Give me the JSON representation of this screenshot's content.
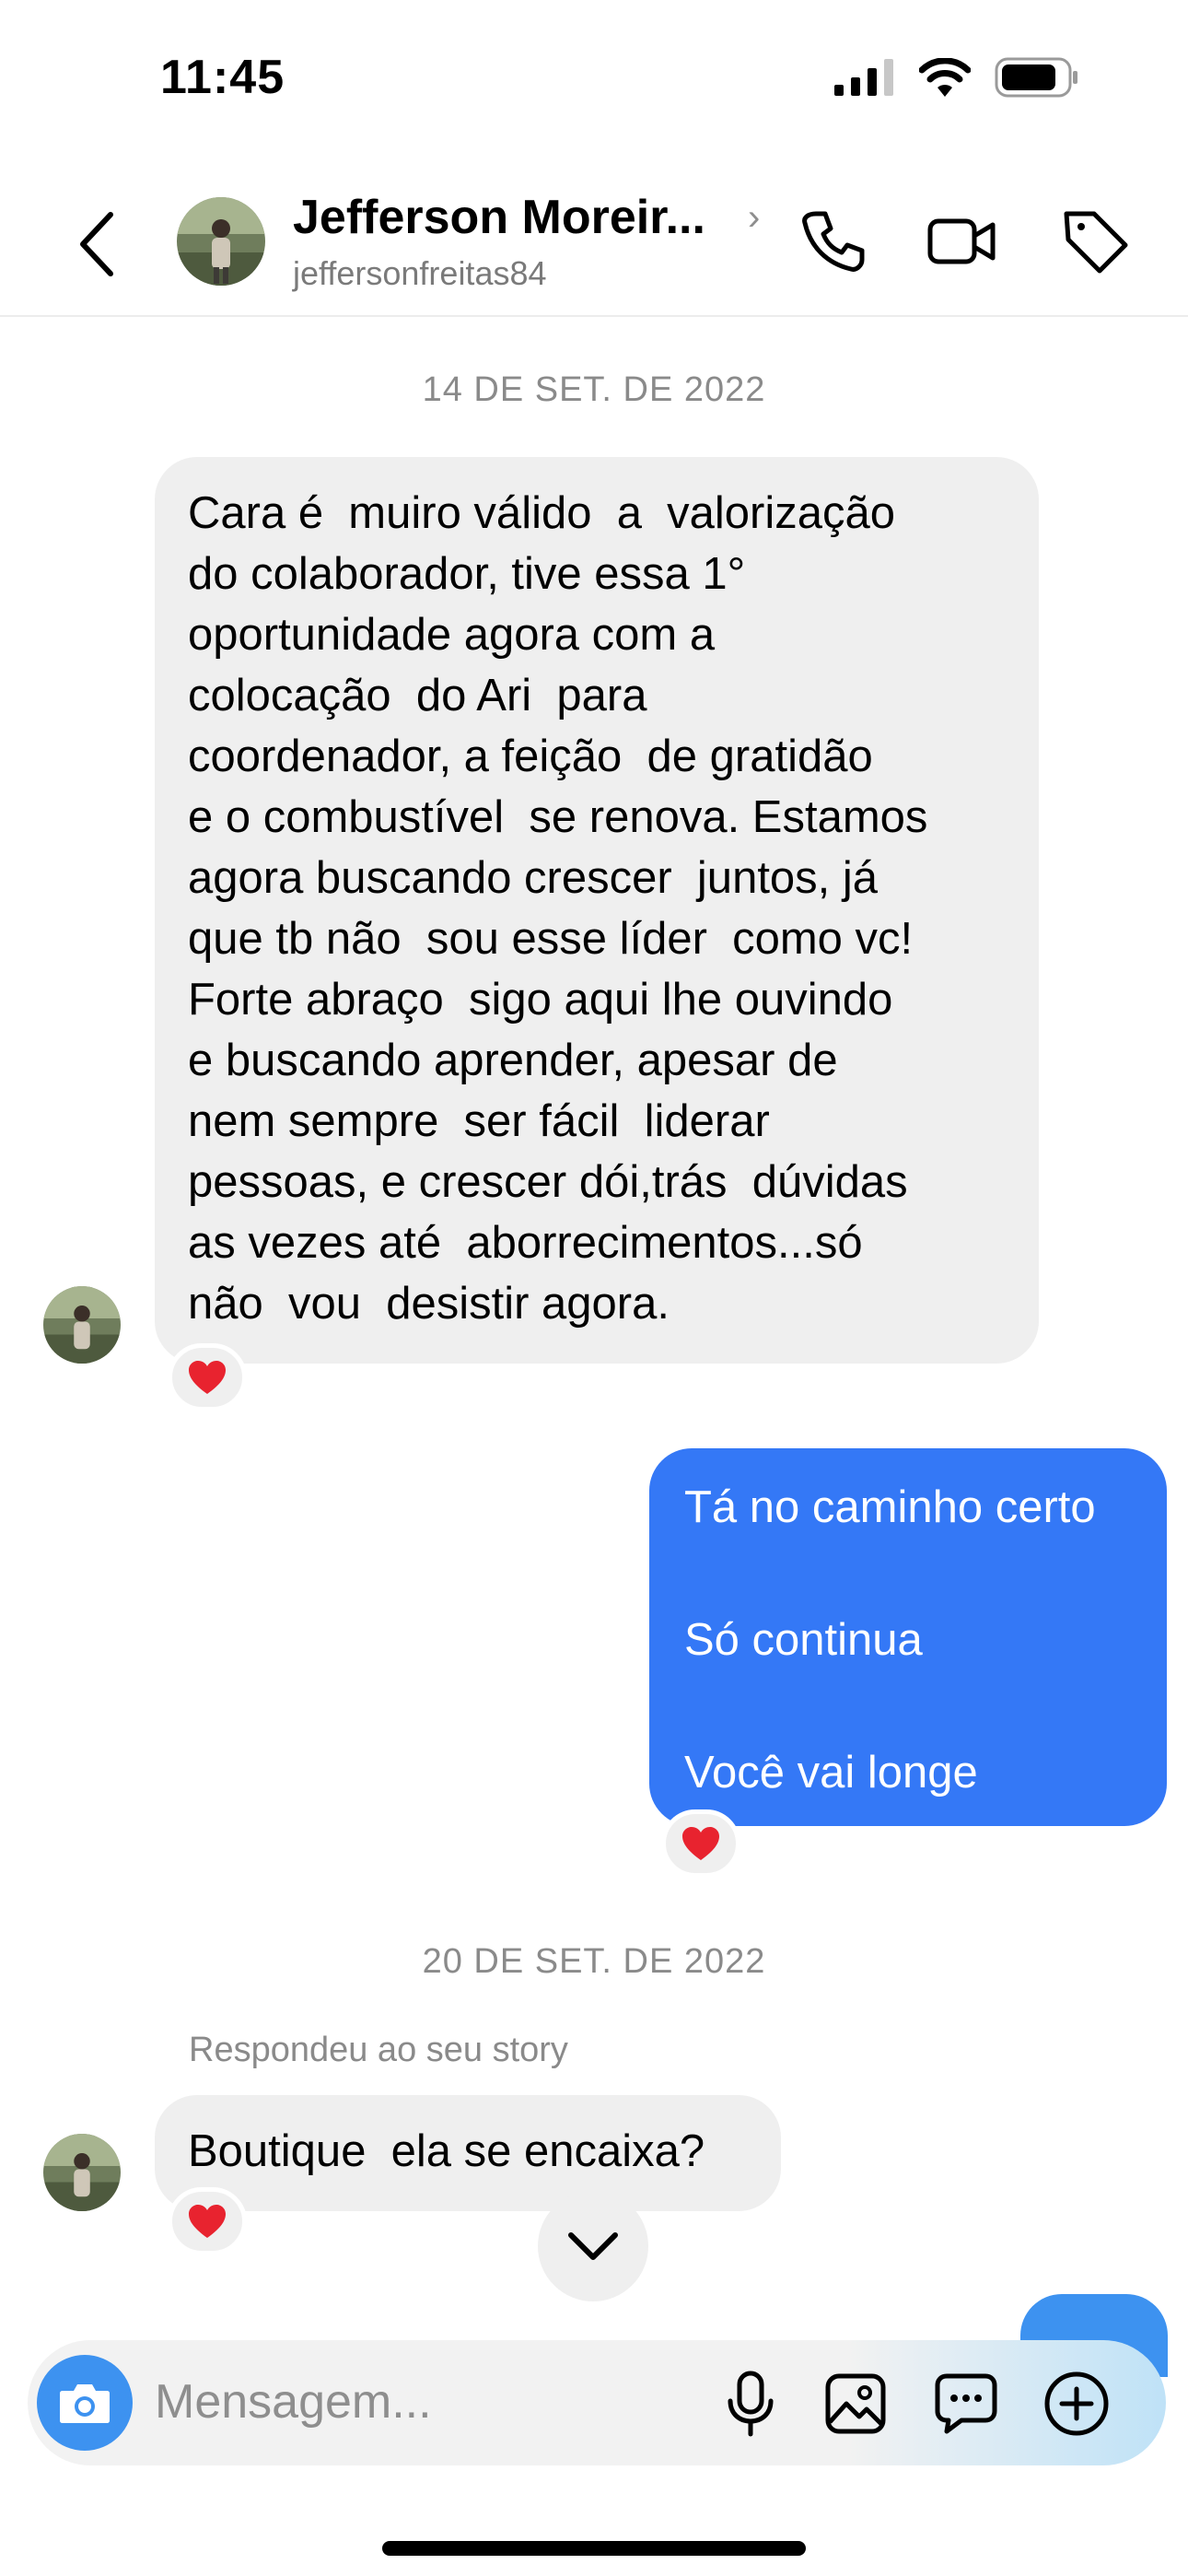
{
  "status_bar": {
    "time": "11:45"
  },
  "header": {
    "name": "Jefferson Moreir...",
    "username": "jeffersonfreitas84",
    "icons": [
      "back-icon",
      "phone-icon",
      "video-icon",
      "tag-icon"
    ]
  },
  "conversation": {
    "date1": "14 DE SET. DE 2022",
    "msg1": "Cara é  muiro válido  a  valorização\ndo colaborador, tive essa 1°\noportunidade agora com a\ncolocação  do Ari  para\ncoordenador, a feição  de gratidão\ne o combustível  se renova. Estamos\nagora buscando crescer  juntos, já\nque tb não  sou esse líder  como vc!\nForte abraço  sigo aqui lhe ouvindo\ne buscando aprender, apesar de\nnem sempre  ser fácil  liderar\npessoas, e crescer dói,trás  dúvidas\nas vezes até  aborrecimentos...só\nnão  vou  desistir agora.",
    "msg1_reaction": "❤️",
    "msg2": "Tá no caminho certo\n\nSó continua\n\nVocê vai longe",
    "msg2_reaction": "❤️",
    "date2": "20 DE SET. DE 2022",
    "reply_label": "Respondeu ao seu story",
    "msg3": "Boutique  ela se encaixa?",
    "msg3_reaction": "❤️"
  },
  "composer": {
    "placeholder": "Mensagem...",
    "icons": [
      "camera-icon",
      "microphone-icon",
      "gallery-icon",
      "sticker-icon",
      "plus-icon"
    ]
  },
  "colors": {
    "outgoing_bubble": "#3478f6",
    "incoming_bubble": "#efefef",
    "camera_button": "#3d92f0"
  }
}
